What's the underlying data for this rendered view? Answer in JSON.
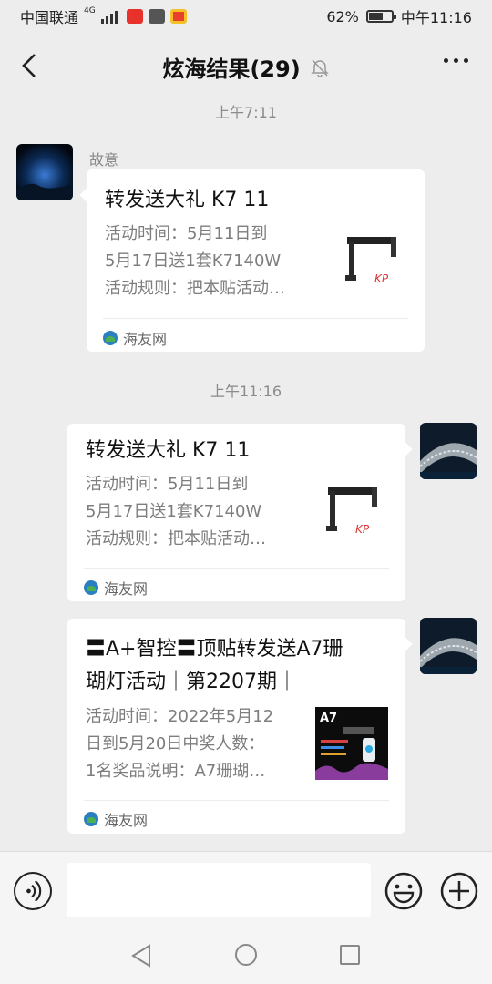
{
  "status_bar": {
    "carrier": "中国联通",
    "network": "4G",
    "battery": "62%",
    "time": "中午11:16"
  },
  "header": {
    "title": "炫海结果(29)"
  },
  "chat": {
    "messages": [
      {
        "time": "上午7:11",
        "sender": "故意",
        "title": "转发送大礼 K7 11",
        "desc_lines": [
          "活动时间：5月11日到",
          "5月17日送1套K7140W",
          "活动规则：把本贴活动…"
        ],
        "source": "海友网"
      },
      {
        "time": "上午11:16",
        "title": "转发送大礼 K7 11",
        "desc_lines": [
          "活动时间：5月11日到",
          "5月17日送1套K7140W",
          "活动规则：把本贴活动…"
        ],
        "source": "海友网"
      },
      {
        "title_lines": [
          "〓A+智控〓顶贴转发送A7珊",
          "瑚灯活动｜第2207期｜"
        ],
        "desc_lines": [
          "活动时间：2022年5月12",
          "日到5月20日中奖人数：",
          "1名奖品说明：A7珊瑚…"
        ],
        "thumb_label": "A7",
        "source": "海友网"
      }
    ]
  },
  "colors": {
    "background": "#ededed",
    "card": "#ffffff"
  }
}
